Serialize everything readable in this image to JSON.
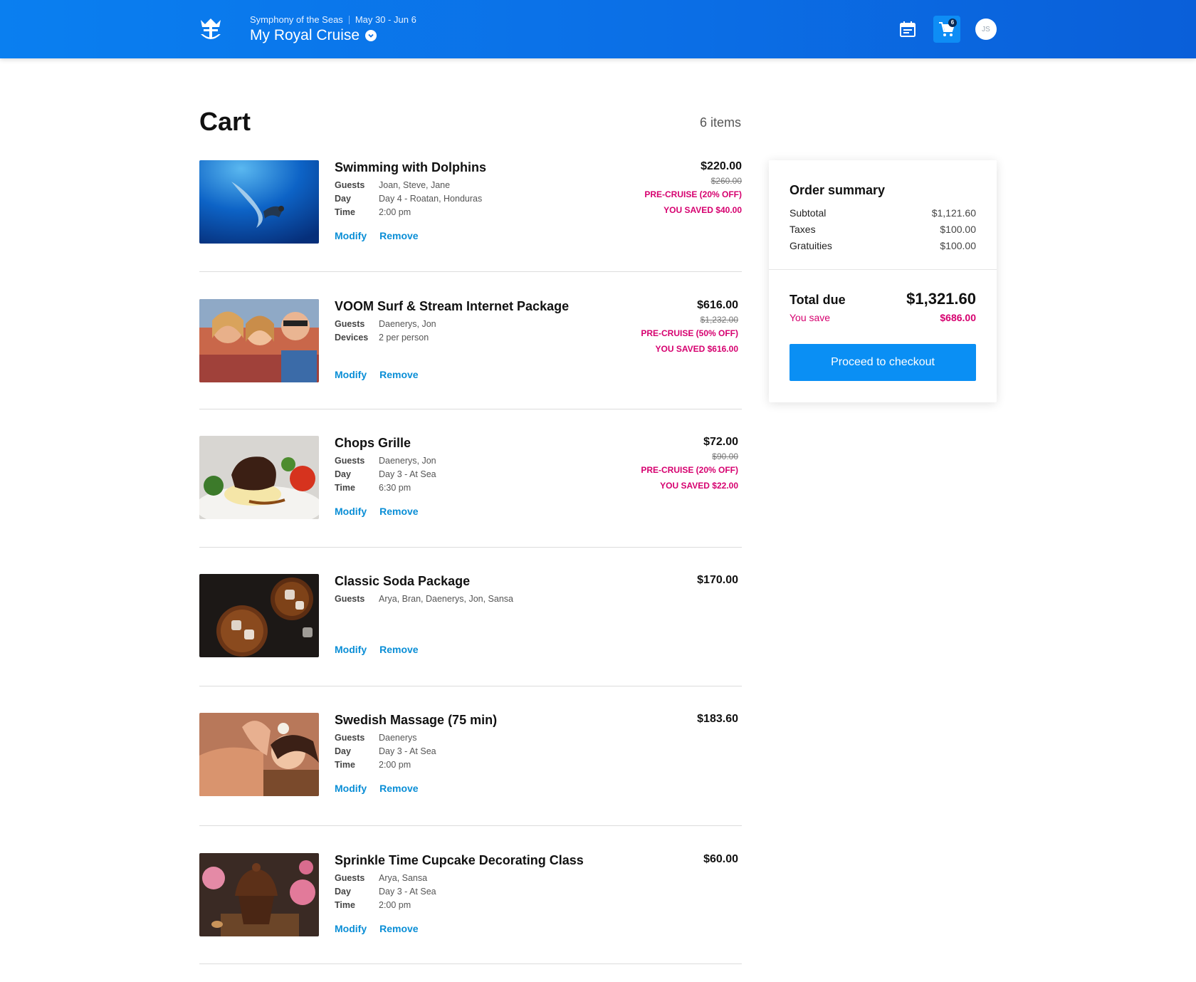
{
  "header": {
    "ship": "Symphony of the Seas",
    "dates": "May 30 - Jun 6",
    "title": "My Royal Cruise",
    "cart_count": "6",
    "avatar_initials": "JS",
    "icons": [
      "crown-anchor-logo",
      "calendar-icon",
      "cart-icon",
      "chevron-down-icon"
    ]
  },
  "cart": {
    "title": "Cart",
    "count_label": "6 items",
    "modify_label": "Modify",
    "remove_label": "Remove",
    "items": [
      {
        "name": "Swimming with Dolphins",
        "details": [
          {
            "label": "Guests",
            "value": "Joan, Steve, Jane"
          },
          {
            "label": "Day",
            "value": "Day 4 - Roatan, Honduras"
          },
          {
            "label": "Time",
            "value": "2:00 pm"
          }
        ],
        "price": "$220.00",
        "original_price": "$260.00",
        "promo": "PRE-CRUISE (20% OFF)",
        "saved": "YOU SAVED $40.00"
      },
      {
        "name": "VOOM Surf & Stream Internet Package",
        "details": [
          {
            "label": "Guests",
            "value": "Daenerys, Jon"
          },
          {
            "label": "Devices",
            "value": "2 per person"
          }
        ],
        "price": "$616.00",
        "original_price": "$1,232.00",
        "promo": "PRE-CRUISE (50% OFF)",
        "saved": "YOU SAVED $616.00"
      },
      {
        "name": "Chops Grille",
        "details": [
          {
            "label": "Guests",
            "value": "Daenerys, Jon"
          },
          {
            "label": "Day",
            "value": "Day 3 - At Sea"
          },
          {
            "label": "Time",
            "value": "6:30 pm"
          }
        ],
        "price": "$72.00",
        "original_price": "$90.00",
        "promo": "PRE-CRUISE (20% OFF)",
        "saved": "YOU SAVED $22.00"
      },
      {
        "name": "Classic Soda Package",
        "details": [
          {
            "label": "Guests",
            "value": "Arya, Bran, Daenerys, Jon, Sansa"
          }
        ],
        "price": "$170.00"
      },
      {
        "name": "Swedish Massage (75 min)",
        "details": [
          {
            "label": "Guests",
            "value": "Daenerys"
          },
          {
            "label": "Day",
            "value": "Day 3 - At Sea"
          },
          {
            "label": "Time",
            "value": "2:00 pm"
          }
        ],
        "price": "$183.60"
      },
      {
        "name": "Sprinkle Time Cupcake Decorating Class",
        "details": [
          {
            "label": "Guests",
            "value": "Arya, Sansa"
          },
          {
            "label": "Day",
            "value": "Day 3 - At Sea"
          },
          {
            "label": "Time",
            "value": "2:00 pm"
          }
        ],
        "price": "$60.00"
      }
    ]
  },
  "summary": {
    "title": "Order summary",
    "subtotal_label": "Subtotal",
    "subtotal": "$1,121.60",
    "taxes_label": "Taxes",
    "taxes": "$100.00",
    "gratuities_label": "Gratuities",
    "gratuities": "$100.00",
    "total_label": "Total due",
    "total": "$1,321.60",
    "save_label": "You save",
    "save": "$686.00",
    "checkout_label": "Proceed to checkout"
  },
  "colors": {
    "header_blue": "#0b6fe6",
    "link_blue": "#0a8ed6",
    "promo_pink": "#d6006f",
    "button_blue": "#0a8ff4"
  }
}
